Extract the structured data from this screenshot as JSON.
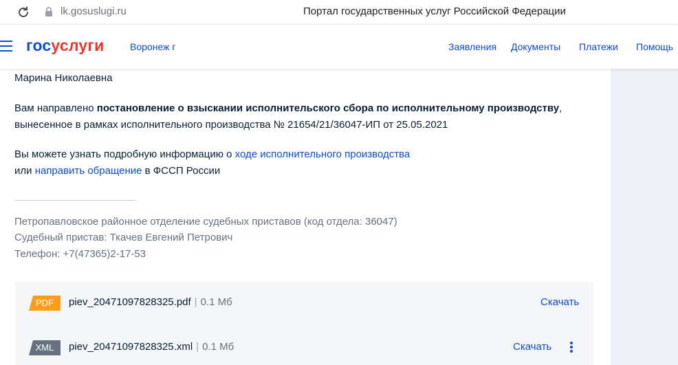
{
  "browser": {
    "url": "lk.gosuslugi.ru",
    "tab_title": "Портал государственных услуг Российской Федерации"
  },
  "header": {
    "logo_part1": "гос",
    "logo_part2": "услуги",
    "region": "Воронеж г",
    "nav": [
      "Заявления",
      "Документы",
      "Платежи",
      "Помощь"
    ]
  },
  "message": {
    "greeting": "Марина Николаевна",
    "line1_prefix": "Вам направлено ",
    "line1_bold": "постановление о взыскании исполнительского сбора по исполнительному производству",
    "line1_suffix": ",",
    "line2": "вынесенное в рамках исполнительного производства № 21654/21/36047-ИП от 25.05.2021",
    "info_prefix": "Вы можете узнать подробную информацию о ",
    "info_link": "ходе исполнительного производства",
    "appeal_prefix": "или ",
    "appeal_link": "направить обращение",
    "appeal_suffix": " в ФССП России"
  },
  "signature": {
    "department": "Петропавловское районное отделение судебных приставов (код отдела: 36047)",
    "officer": "Судебный пристав: Ткачев Евгений Петрович",
    "phone": "Телефон: +7(47365)2-17-53"
  },
  "files": [
    {
      "type": "PDF",
      "name": "piev_20471097828325.pdf",
      "separator": "|",
      "size": "0.1 Мб",
      "download": "Скачать",
      "color": "#ff9e1b"
    },
    {
      "type": "XML",
      "name": "piev_20471097828325.xml",
      "separator": "|",
      "size": "0.1 Мб",
      "download": "Скачать",
      "color": "#66727f"
    }
  ],
  "colors": {
    "accent": "#0d4cd3",
    "logo_red": "#e8372d",
    "text": "#0b1f33",
    "muted": "#66727f"
  }
}
